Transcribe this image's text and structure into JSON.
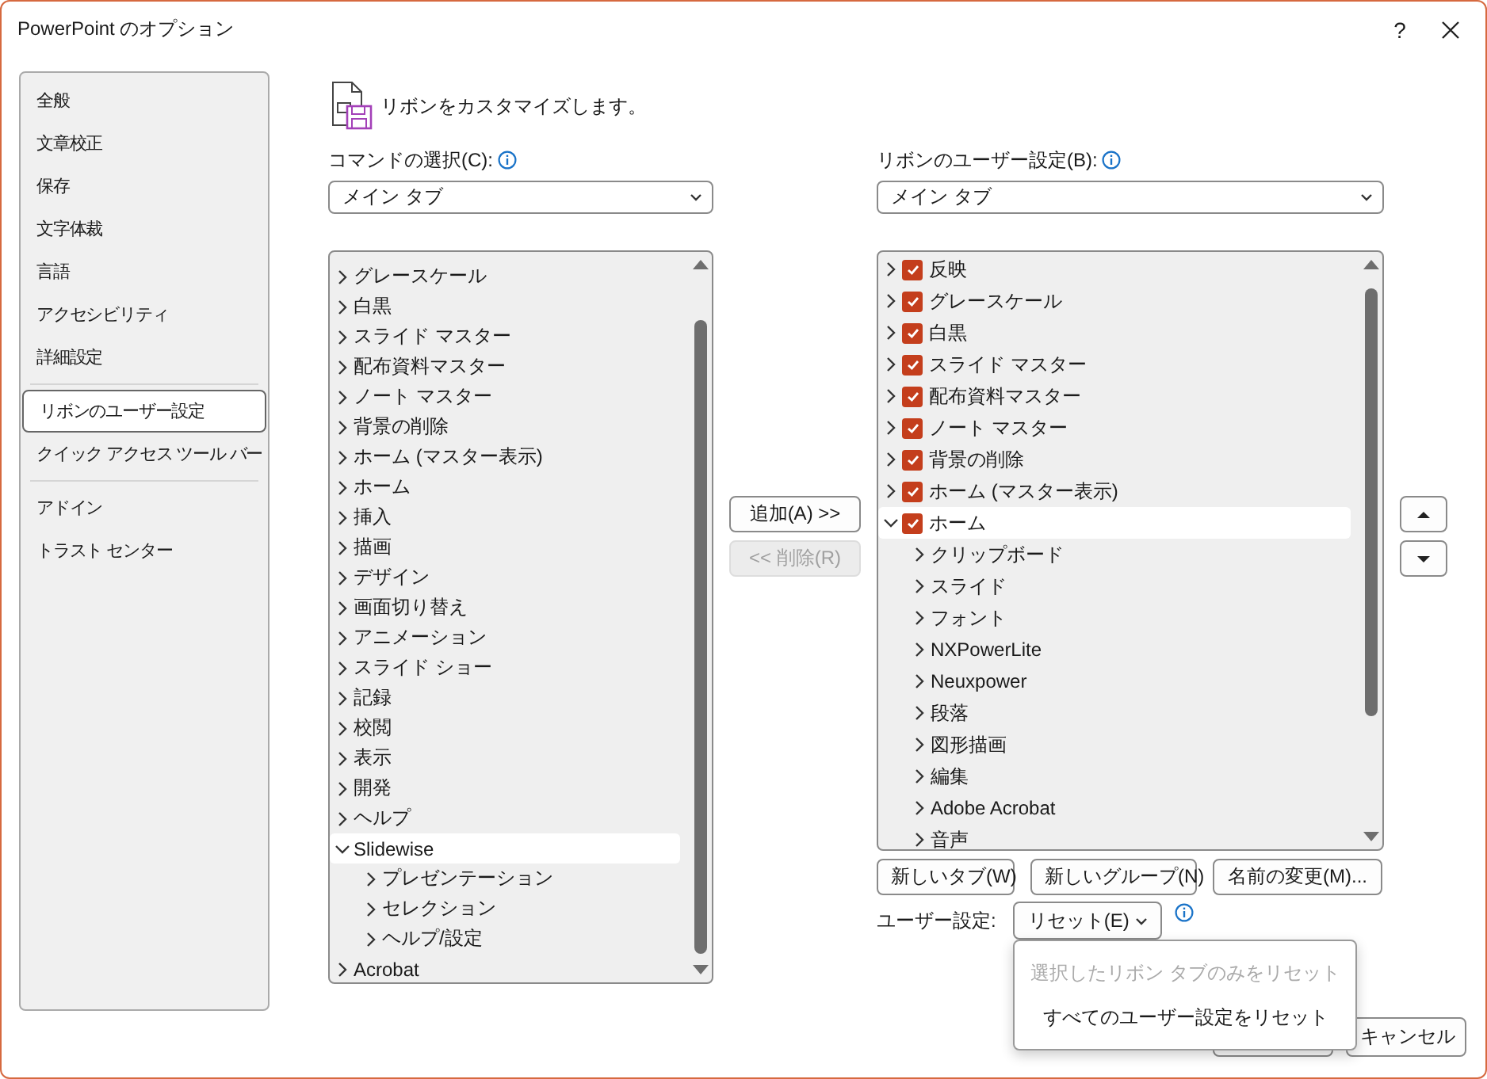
{
  "window": {
    "title": "PowerPoint のオプション",
    "help": "?"
  },
  "nav": {
    "items": [
      {
        "label": "全般",
        "selected": false,
        "divider_after": false
      },
      {
        "label": "文章校正",
        "selected": false,
        "divider_after": false
      },
      {
        "label": "保存",
        "selected": false,
        "divider_after": false
      },
      {
        "label": "文字体裁",
        "selected": false,
        "divider_after": false
      },
      {
        "label": "言語",
        "selected": false,
        "divider_after": false
      },
      {
        "label": "アクセシビリティ",
        "selected": false,
        "divider_after": false
      },
      {
        "label": "詳細設定",
        "selected": false,
        "divider_after": true
      },
      {
        "label": "リボンのユーザー設定",
        "selected": true,
        "divider_after": false
      },
      {
        "label": "クイック アクセス ツール バー",
        "selected": false,
        "divider_after": true
      },
      {
        "label": "アドイン",
        "selected": false,
        "divider_after": false
      },
      {
        "label": "トラスト センター",
        "selected": false,
        "divider_after": false
      }
    ]
  },
  "heading": "リボンをカスタマイズします。",
  "commands": {
    "label": "コマンドの選択(C):",
    "dropdown": "メイン タブ",
    "tree": [
      {
        "label": "グレースケール",
        "expanded": false,
        "selected": false
      },
      {
        "label": "白黒",
        "expanded": false,
        "selected": false
      },
      {
        "label": "スライド マスター",
        "expanded": false,
        "selected": false
      },
      {
        "label": "配布資料マスター",
        "expanded": false,
        "selected": false
      },
      {
        "label": "ノート マスター",
        "expanded": false,
        "selected": false
      },
      {
        "label": "背景の削除",
        "expanded": false,
        "selected": false
      },
      {
        "label": "ホーム (マスター表示)",
        "expanded": false,
        "selected": false
      },
      {
        "label": "ホーム",
        "expanded": false,
        "selected": false
      },
      {
        "label": "挿入",
        "expanded": false,
        "selected": false
      },
      {
        "label": "描画",
        "expanded": false,
        "selected": false
      },
      {
        "label": "デザイン",
        "expanded": false,
        "selected": false
      },
      {
        "label": "画面切り替え",
        "expanded": false,
        "selected": false
      },
      {
        "label": "アニメーション",
        "expanded": false,
        "selected": false
      },
      {
        "label": "スライド ショー",
        "expanded": false,
        "selected": false
      },
      {
        "label": "記録",
        "expanded": false,
        "selected": false
      },
      {
        "label": "校閲",
        "expanded": false,
        "selected": false
      },
      {
        "label": "表示",
        "expanded": false,
        "selected": false
      },
      {
        "label": "開発",
        "expanded": false,
        "selected": false
      },
      {
        "label": "ヘルプ",
        "expanded": false,
        "selected": false
      },
      {
        "label": "Slidewise",
        "expanded": true,
        "selected": true,
        "children": [
          {
            "label": "プレゼンテーション",
            "expanded": false,
            "selected": false
          },
          {
            "label": "セレクション",
            "expanded": false,
            "selected": false
          },
          {
            "label": "ヘルプ/設定",
            "expanded": false,
            "selected": false
          }
        ]
      },
      {
        "label": "Acrobat",
        "expanded": false,
        "selected": false
      }
    ]
  },
  "transfer": {
    "add": {
      "label": "追加(A) >>",
      "disabled": false
    },
    "remove": {
      "label": "<< 削除(R)",
      "disabled": true
    }
  },
  "ribbon": {
    "label": "リボンのユーザー設定(B):",
    "dropdown": "メイン タブ",
    "tree": [
      {
        "label": "反映",
        "expanded": false,
        "checked": true,
        "selected": false
      },
      {
        "label": "グレースケール",
        "expanded": false,
        "checked": true,
        "selected": false
      },
      {
        "label": "白黒",
        "expanded": false,
        "checked": true,
        "selected": false
      },
      {
        "label": "スライド マスター",
        "expanded": false,
        "checked": true,
        "selected": false
      },
      {
        "label": "配布資料マスター",
        "expanded": false,
        "checked": true,
        "selected": false
      },
      {
        "label": "ノート マスター",
        "expanded": false,
        "checked": true,
        "selected": false
      },
      {
        "label": "背景の削除",
        "expanded": false,
        "checked": true,
        "selected": false
      },
      {
        "label": "ホーム (マスター表示)",
        "expanded": false,
        "checked": true,
        "selected": false
      },
      {
        "label": "ホーム",
        "expanded": true,
        "checked": true,
        "selected": true,
        "children": [
          {
            "label": "クリップボード",
            "expanded": false,
            "selected": false
          },
          {
            "label": "スライド",
            "expanded": false,
            "selected": false
          },
          {
            "label": "フォント",
            "expanded": false,
            "selected": false
          },
          {
            "label": "NXPowerLite",
            "expanded": false,
            "selected": false
          },
          {
            "label": "Neuxpower",
            "expanded": false,
            "selected": false
          },
          {
            "label": "段落",
            "expanded": false,
            "selected": false
          },
          {
            "label": "図形描画",
            "expanded": false,
            "selected": false
          },
          {
            "label": "編集",
            "expanded": false,
            "selected": false
          },
          {
            "label": "Adobe Acrobat",
            "expanded": false,
            "selected": false
          },
          {
            "label": "音声",
            "expanded": false,
            "selected": false
          }
        ]
      }
    ],
    "buttons": [
      "新しいタブ(W)",
      "新しいグループ(N)",
      "名前の変更(M)..."
    ],
    "customizations_label": "ユーザー設定:",
    "reset_button": "リセット(E)",
    "reset_menu": [
      {
        "label": "選択したリボン タブのみをリセット",
        "disabled": true
      },
      {
        "label": "すべてのユーザー設定をリセット",
        "disabled": false
      }
    ]
  },
  "footer": {
    "cancel": "キャンセル"
  }
}
